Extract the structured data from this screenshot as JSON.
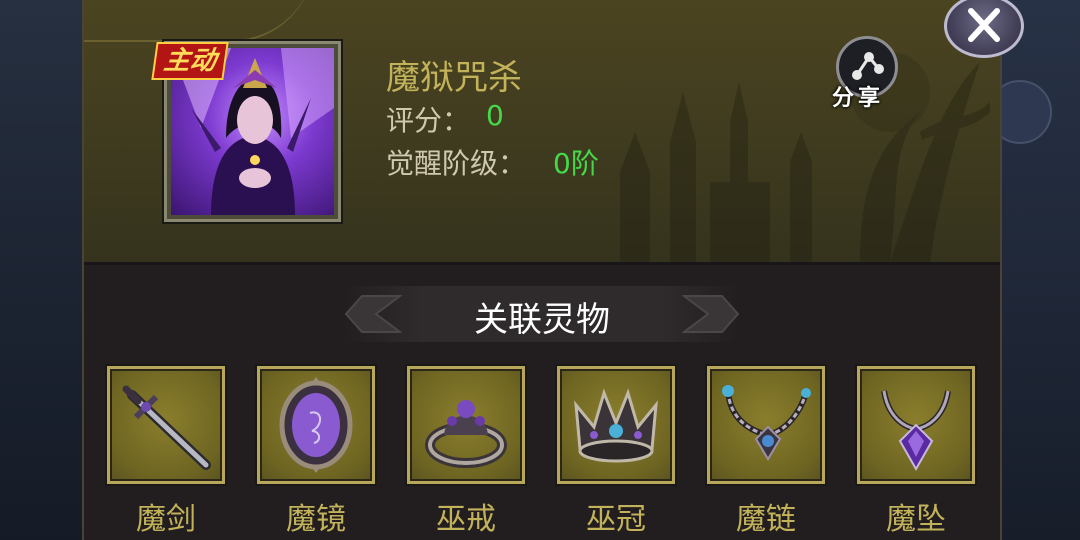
{
  "skill": {
    "tag": "主动",
    "name": "魔狱咒杀",
    "score_label": "评分：",
    "score_value": "0",
    "awaken_label": "觉醒阶级：",
    "awaken_value": "0阶"
  },
  "share": {
    "label": "分享",
    "icon": "share-icon"
  },
  "close": {
    "icon": "close-icon"
  },
  "section": {
    "title": "关联灵物"
  },
  "items": [
    {
      "label": "魔剑",
      "icon": "magic-sword-icon"
    },
    {
      "label": "魔镜",
      "icon": "magic-mirror-icon"
    },
    {
      "label": "巫戒",
      "icon": "witch-ring-icon"
    },
    {
      "label": "巫冠",
      "icon": "witch-crown-icon"
    },
    {
      "label": "魔链",
      "icon": "magic-chain-icon"
    },
    {
      "label": "魔坠",
      "icon": "magic-pendant-icon"
    }
  ],
  "colors": {
    "title_gold": "#c2b35a",
    "value_green": "#45d84a",
    "tag_red": "#b31414"
  }
}
